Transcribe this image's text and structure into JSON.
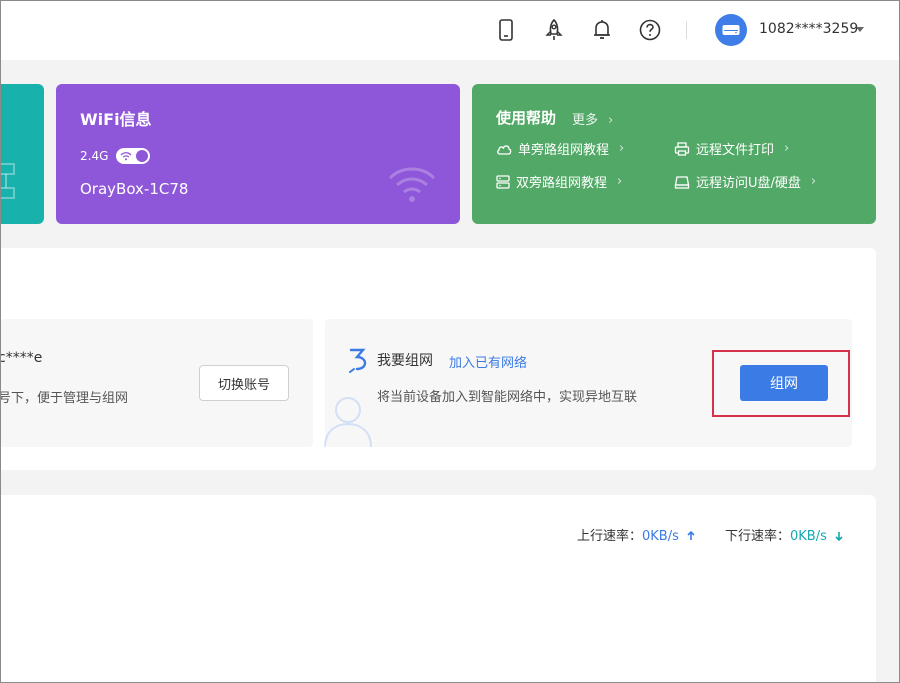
{
  "header": {
    "user_id": "1082****3259",
    "icons": [
      "phone-icon",
      "rocket-icon",
      "bell-icon",
      "help-icon"
    ]
  },
  "wifi_card": {
    "title": "WiFi信息",
    "band": "2.4G",
    "ssid": "OrayBox-1C78",
    "toggle_on": true
  },
  "help_card": {
    "title": "使用帮助",
    "more": "更多",
    "links": [
      {
        "label": "单旁路组网教程",
        "icon": "cloud-icon"
      },
      {
        "label": "远程文件打印",
        "icon": "printer-icon"
      },
      {
        "label": "双旁路组网教程",
        "icon": "server-icon"
      },
      {
        "label": "远程访问U盘/硬盘",
        "icon": "drive-icon"
      }
    ]
  },
  "account": {
    "masked": "c****e",
    "desc": "号下，便于管理与组网",
    "switch_label": "切换账号"
  },
  "network": {
    "title": "我要组网",
    "join_link": "加入已有网络",
    "desc": "将当前设备加入到智能网络中，实现异地互联",
    "button": "组网"
  },
  "speed": {
    "up_label": "上行速率：",
    "up_value": "0KB/s",
    "down_label": "下行速率：",
    "down_value": "0KB/s"
  },
  "colors": {
    "teal": "#18b1ac",
    "purple": "#8e56d8",
    "green": "#52a866",
    "primary": "#3b7be6",
    "highlight": "#d4314d"
  }
}
